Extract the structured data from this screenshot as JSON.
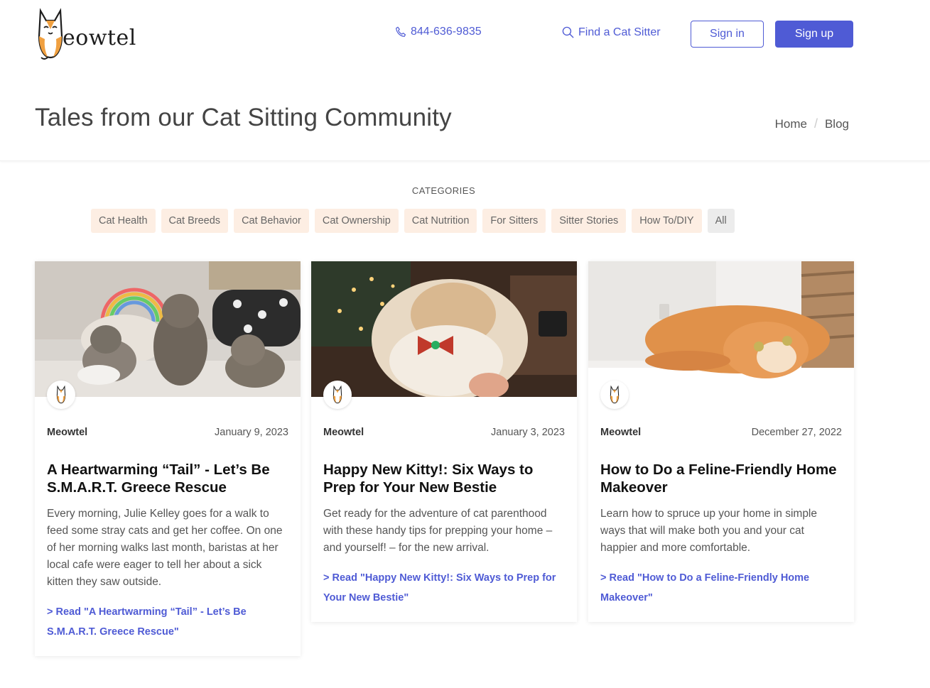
{
  "brand": {
    "name": "eowtel"
  },
  "header": {
    "phone": "844-636-9835",
    "find_sitter": "Find a Cat Sitter",
    "signin": "Sign in",
    "signup": "Sign up"
  },
  "page": {
    "title": "Tales from our Cat Sitting Community",
    "breadcrumb": [
      "Home",
      "Blog"
    ]
  },
  "categories": {
    "heading": "CATEGORIES",
    "items": [
      "Cat Health",
      "Cat Breeds",
      "Cat Behavior",
      "Cat Ownership",
      "Cat Nutrition",
      "For Sitters",
      "Sitter Stories",
      "How To/DIY",
      "All"
    ]
  },
  "posts": [
    {
      "author": "Meowtel",
      "date": "January 9, 2023",
      "title": "A Heartwarming “Tail” - Let’s Be S.M.A.R.T. Greece Rescue",
      "excerpt": "Every morning, Julie Kelley goes for a walk to feed some stray cats and get her coffee. On one of her morning walks last month, baristas at her local cafe were eager to tell her about a sick kitten they saw outside.",
      "read_more": "> Read \"A Heartwarming “Tail” - Let’s Be S.M.A.R.T. Greece Rescue\""
    },
    {
      "author": "Meowtel",
      "date": "January 3, 2023",
      "title": "Happy New Kitty!: Six Ways to Prep for Your New Bestie",
      "excerpt": "Get ready for the adventure of cat parenthood with these handy tips for prepping your home – and yourself! – for the new arrival.",
      "read_more": "> Read \"Happy New Kitty!: Six Ways to Prep for Your New Bestie\""
    },
    {
      "author": "Meowtel",
      "date": "December 27, 2022",
      "title": "How to Do a Feline-Friendly Home Makeover",
      "excerpt": "Learn how to spruce up your home in simple ways that will make both you and your cat happier and more comfortable.",
      "read_more": "> Read \"How to Do a Feline-Friendly Home Makeover\""
    }
  ],
  "colors": {
    "accent": "#4f5bd5",
    "chip_bg": "#fdeee3",
    "chip_all_bg": "#ececec",
    "logo_orange": "#f0a040"
  },
  "icons": {
    "logo": "cat-logo-icon",
    "phone": "phone-icon",
    "find": "search-icon",
    "avatar": "cat-avatar-icon"
  }
}
